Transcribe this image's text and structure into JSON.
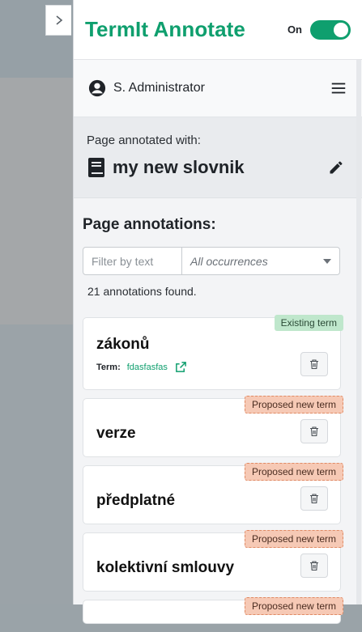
{
  "panel": {
    "app_title": "TermIt Annotate",
    "toggle_label": "On",
    "toggle_on": true,
    "accent_color": "#0f9f6e"
  },
  "user": {
    "name": "S. Administrator",
    "user_icon": "account-circle-icon",
    "menu_icon": "hamburger-menu-icon"
  },
  "vocabulary": {
    "caption": "Page annotated with:",
    "name": "my new slovnik",
    "book_icon": "book-icon",
    "edit_icon": "pencil-icon"
  },
  "annotations": {
    "title": "Page annotations:",
    "filter_placeholder": "Filter by text",
    "filter_value": "",
    "occurrence_select": "All occurrences",
    "count_text": "21 annotations found.",
    "items": [
      {
        "text": "zákonů",
        "badge": "Existing term",
        "term_label": "Term:",
        "term_name": "fdasfasfas"
      },
      {
        "text": "verze",
        "badge": "Proposed new term"
      },
      {
        "text": "předplatné",
        "badge": "Proposed new term"
      },
      {
        "text": "kolektivní smlouvy",
        "badge": "Proposed new term"
      },
      {
        "text": "",
        "badge": "Proposed new term"
      }
    ]
  },
  "colors": {
    "existing_badge": "#bfe7cc",
    "proposed_badge": "#f6c9b5"
  }
}
